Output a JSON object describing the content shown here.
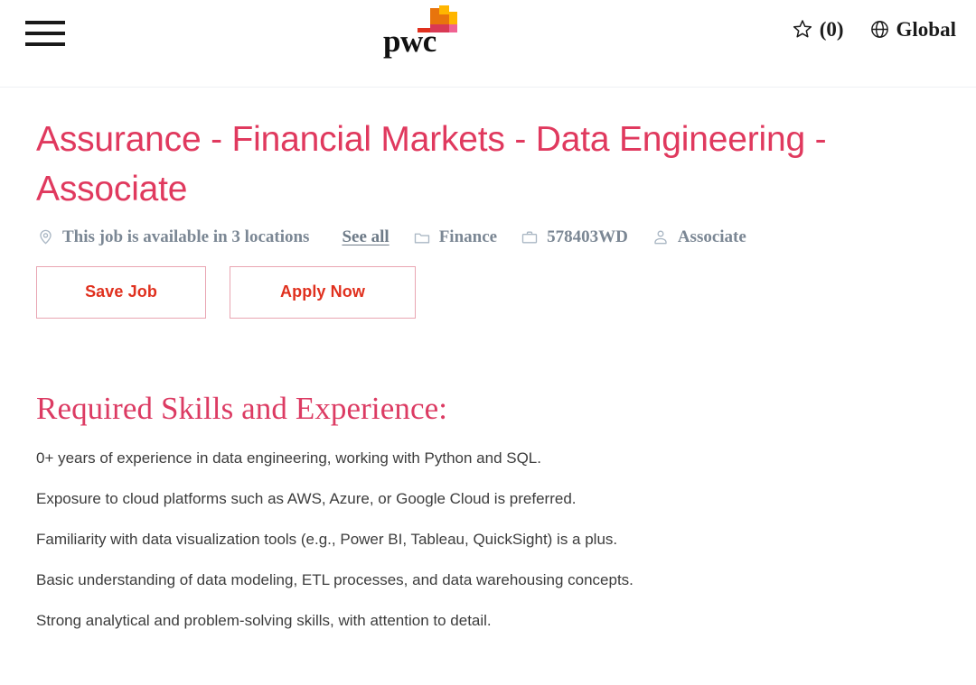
{
  "header": {
    "menu_icon": "hamburger-menu-icon",
    "logo": {
      "wordmark": "pwc",
      "mark_colors": [
        "#ffb600",
        "#e8740c",
        "#d93954",
        "#e0301e",
        "#f06292"
      ]
    },
    "saved_jobs": {
      "icon": "star-outline-icon",
      "count_label": "(0)"
    },
    "region": {
      "icon": "globe-icon",
      "label": "Global"
    }
  },
  "job": {
    "title": "Assurance - Financial Markets - Data Engineering - Associate",
    "title_color": "#e0395e",
    "meta": [
      {
        "icon": "location-pin-icon",
        "label": "This job is available in 3 locations"
      },
      {
        "icon": "folder-icon",
        "label": "Finance"
      },
      {
        "icon": "briefcase-icon",
        "label": "578403WD"
      },
      {
        "icon": "person-icon",
        "label": "Associate"
      }
    ],
    "see_all_label": "See all",
    "buttons": {
      "save_label": "Save Job",
      "apply_label": "Apply Now",
      "text_color": "#e0301e",
      "border_color": "#e9a5b2"
    }
  },
  "content": {
    "heading": "Required Skills and Experience:",
    "heading_color": "#dc3b63",
    "paragraphs": [
      "0+ years of experience in data engineering, working with Python and SQL.",
      "Exposure to cloud platforms such as AWS, Azure, or Google Cloud is preferred.",
      "Familiarity with data visualization tools (e.g., Power BI, Tableau, QuickSight) is a plus.",
      "Basic understanding of data modeling, ETL processes, and data warehousing concepts.",
      "Strong analytical and problem-solving skills, with attention to detail."
    ]
  }
}
